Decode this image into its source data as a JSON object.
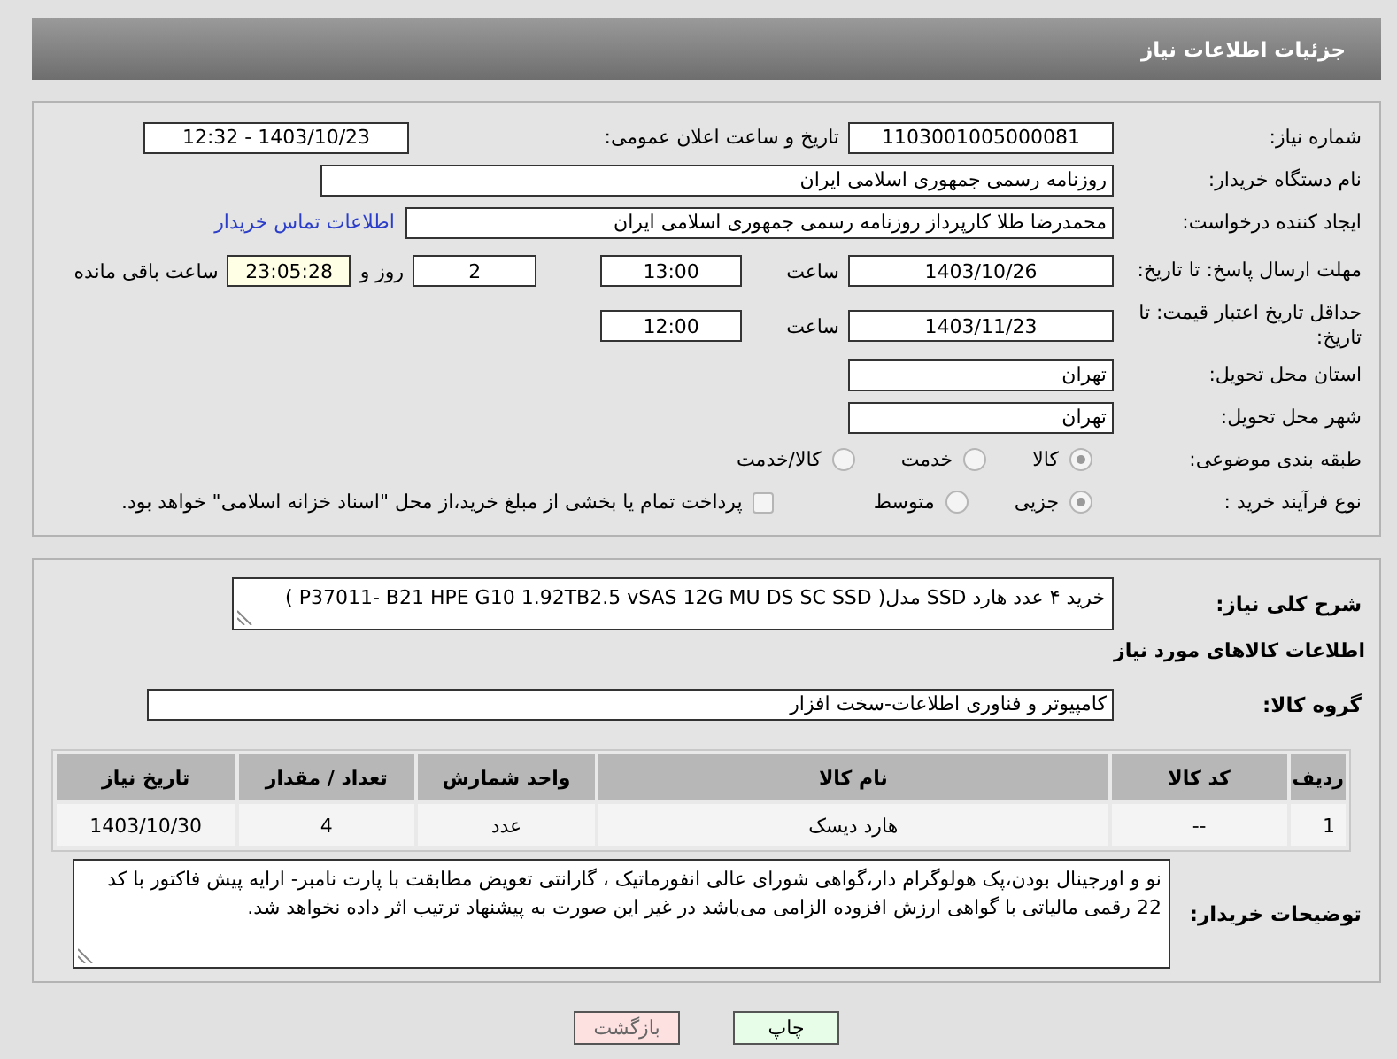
{
  "header": {
    "title": "جزئیات اطلاعات نیاز"
  },
  "details": {
    "need_number": {
      "label": "شماره نیاز:",
      "value": "1103001005000081"
    },
    "announce": {
      "label": "تاریخ و ساعت اعلان عمومی:",
      "value": "1403/10/23 - 12:32"
    },
    "buyer_org": {
      "label": "نام دستگاه خریدار:",
      "value": "روزنامه رسمی جمهوری اسلامی ایران"
    },
    "requester": {
      "label": "ایجاد کننده درخواست:",
      "value": "محمدرضا طلا کارپرداز روزنامه رسمی جمهوری اسلامی ایران",
      "link": "اطلاعات تماس خریدار"
    },
    "reply_deadline": {
      "label": "مهلت ارسال پاسخ: تا تاریخ:",
      "date": "1403/10/26",
      "time_label": "ساعت",
      "time": "13:00",
      "days": "2",
      "days_label": "روز و",
      "remaining": "23:05:28",
      "remaining_label": "ساعت باقی مانده"
    },
    "price_validity": {
      "label": "حداقل تاریخ اعتبار قیمت: تا تاریخ:",
      "date": "1403/11/23",
      "time_label": "ساعت",
      "time": "12:00"
    },
    "province": {
      "label": "استان محل تحویل:",
      "value": "تهران"
    },
    "city": {
      "label": "شهر محل تحویل:",
      "value": "تهران"
    },
    "category": {
      "label": "طبقه بندی موضوعی:",
      "options": [
        {
          "label": "کالا",
          "selected": true
        },
        {
          "label": "خدمت",
          "selected": false
        },
        {
          "label": "کالا/خدمت",
          "selected": false
        }
      ]
    },
    "process": {
      "label": "نوع فرآیند خرید :",
      "options": [
        {
          "label": "جزیی",
          "selected": true
        },
        {
          "label": "متوسط",
          "selected": false
        }
      ],
      "payment_note": {
        "label": "پرداخت تمام یا بخشی از مبلغ خرید،از محل \"اسناد خزانه اسلامی\" خواهد بود.",
        "checked": false
      }
    }
  },
  "summary": {
    "label": "شرح کلی نیاز:",
    "value": "خرید ۴ عدد هارد SSD مدل( P37011- B21  HPE G10 1.92TB2.5 vSAS 12G MU DS SC SSD )"
  },
  "items_title": "اطلاعات کالاهای مورد نیاز",
  "goods_group": {
    "label": "گروه کالا:",
    "value": "کامپیوتر و فناوری اطلاعات-سخت افزار"
  },
  "table": {
    "columns": [
      "ردیف",
      "کد کالا",
      "نام کالا",
      "واحد شمارش",
      "تعداد / مقدار",
      "تاریخ نیاز"
    ],
    "rows": [
      [
        "1",
        "--",
        "هارد دیسک",
        "عدد",
        "4",
        "1403/10/30"
      ]
    ]
  },
  "buyer_notes": {
    "label": "توضیحات خریدار:",
    "value": "نو و اورجینال بودن،پک هولوگرام دار،گواهی شورای عالی انفورماتیک ، گارانتی تعویض مطابقت با پارت نامبر- ارایه پیش فاکتور با کد 22 رقمی مالیاتی با گواهی ارزش افزوده الزامی می‌باشد در غیر این صورت به پیشنهاد ترتیب اثر داده نخواهد شد."
  },
  "buttons": [
    {
      "label": "چاپ",
      "kind": "print"
    },
    {
      "label": "بازگشت",
      "kind": "back"
    }
  ]
}
